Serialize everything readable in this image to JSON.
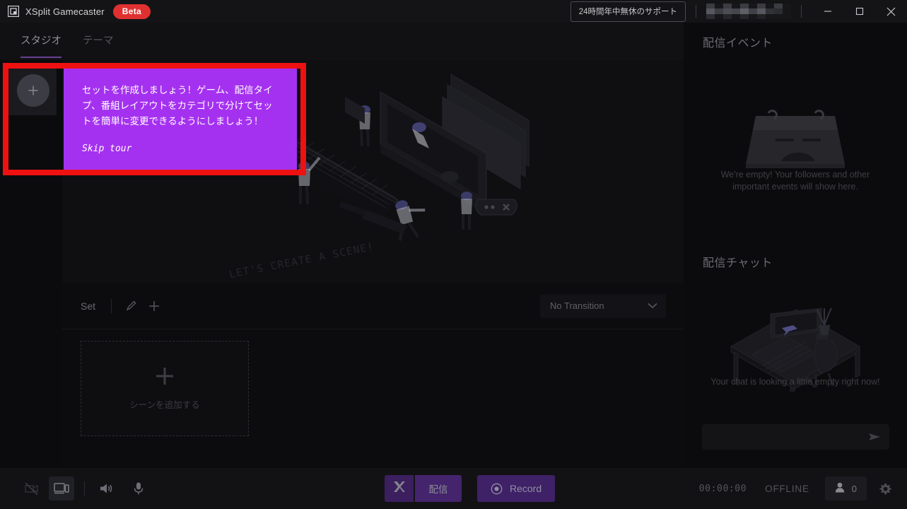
{
  "titlebar": {
    "app_name": "XSplit Gamecaster",
    "badge": "Beta",
    "support_button": "24時間年中無休のサポート",
    "redacted_account": "",
    "logo_icon": "xsplit-logo-icon",
    "minimize_icon": "minimize-icon",
    "maximize_icon": "maximize-icon",
    "close_icon": "close-icon"
  },
  "tabs": [
    {
      "label": "スタジオ",
      "active": true
    },
    {
      "label": "テーマ",
      "active": false
    }
  ],
  "set_strip": {
    "add_set_icon": "plus-icon"
  },
  "tooltip": {
    "body": "セットを作成しましょう！ゲーム、配信タイプ、番組レイアウトをカテゴリで分けてセットを簡単に変更できるようにしましょう！",
    "skip": "Skip tour",
    "background_color": "#a531f0",
    "highlight_color": "#ee1111"
  },
  "canvas": {
    "cta_text": "LET'S CREATE A SCENE!",
    "illustration": "isometric-desk-scene-illustration",
    "arrow_icon": "curved-arrow-icon"
  },
  "set_bar": {
    "label": "Set",
    "edit_icon": "pencil-icon",
    "add_icon": "plus-icon",
    "transition": {
      "value": "No Transition",
      "chevron_icon": "chevron-down-icon"
    }
  },
  "scene_area": {
    "add_scene_label": "シーンを追加する",
    "add_scene_icon": "plus-icon"
  },
  "right_panel": {
    "events": {
      "title": "配信イベント",
      "empty_text": "We're empty! Your followers and other important events will show here.",
      "illustration": "sad-calendar-icon"
    },
    "chat": {
      "title": "配信チャット",
      "empty_text": "Your chat is looking a little empty right now!",
      "illustration": "empty-desk-illustration",
      "input_value": "",
      "input_placeholder": "",
      "send_icon": "send-icon"
    }
  },
  "bottom_bar": {
    "left_icons": [
      {
        "name": "camera-off-icon",
        "state": "disabled"
      },
      {
        "name": "screen-capture-icon",
        "state": "active"
      },
      {
        "name": "speaker-icon",
        "state": "normal"
      },
      {
        "name": "microphone-icon",
        "state": "normal"
      }
    ],
    "xsplit_button_icon": "xsplit-x-icon",
    "stream_button": "配信",
    "record_button": "Record",
    "record_icon": "record-dot-icon",
    "timer": "00:00:00",
    "status": "OFFLINE",
    "viewer_icon": "person-icon",
    "viewer_count": "0",
    "settings_icon": "gear-icon"
  },
  "colors": {
    "accent_purple": "#6a3f96",
    "tooltip_purple": "#a531f0",
    "highlight_red": "#ee1111",
    "beta_red": "#e03131",
    "button_purple": "#44246c"
  }
}
